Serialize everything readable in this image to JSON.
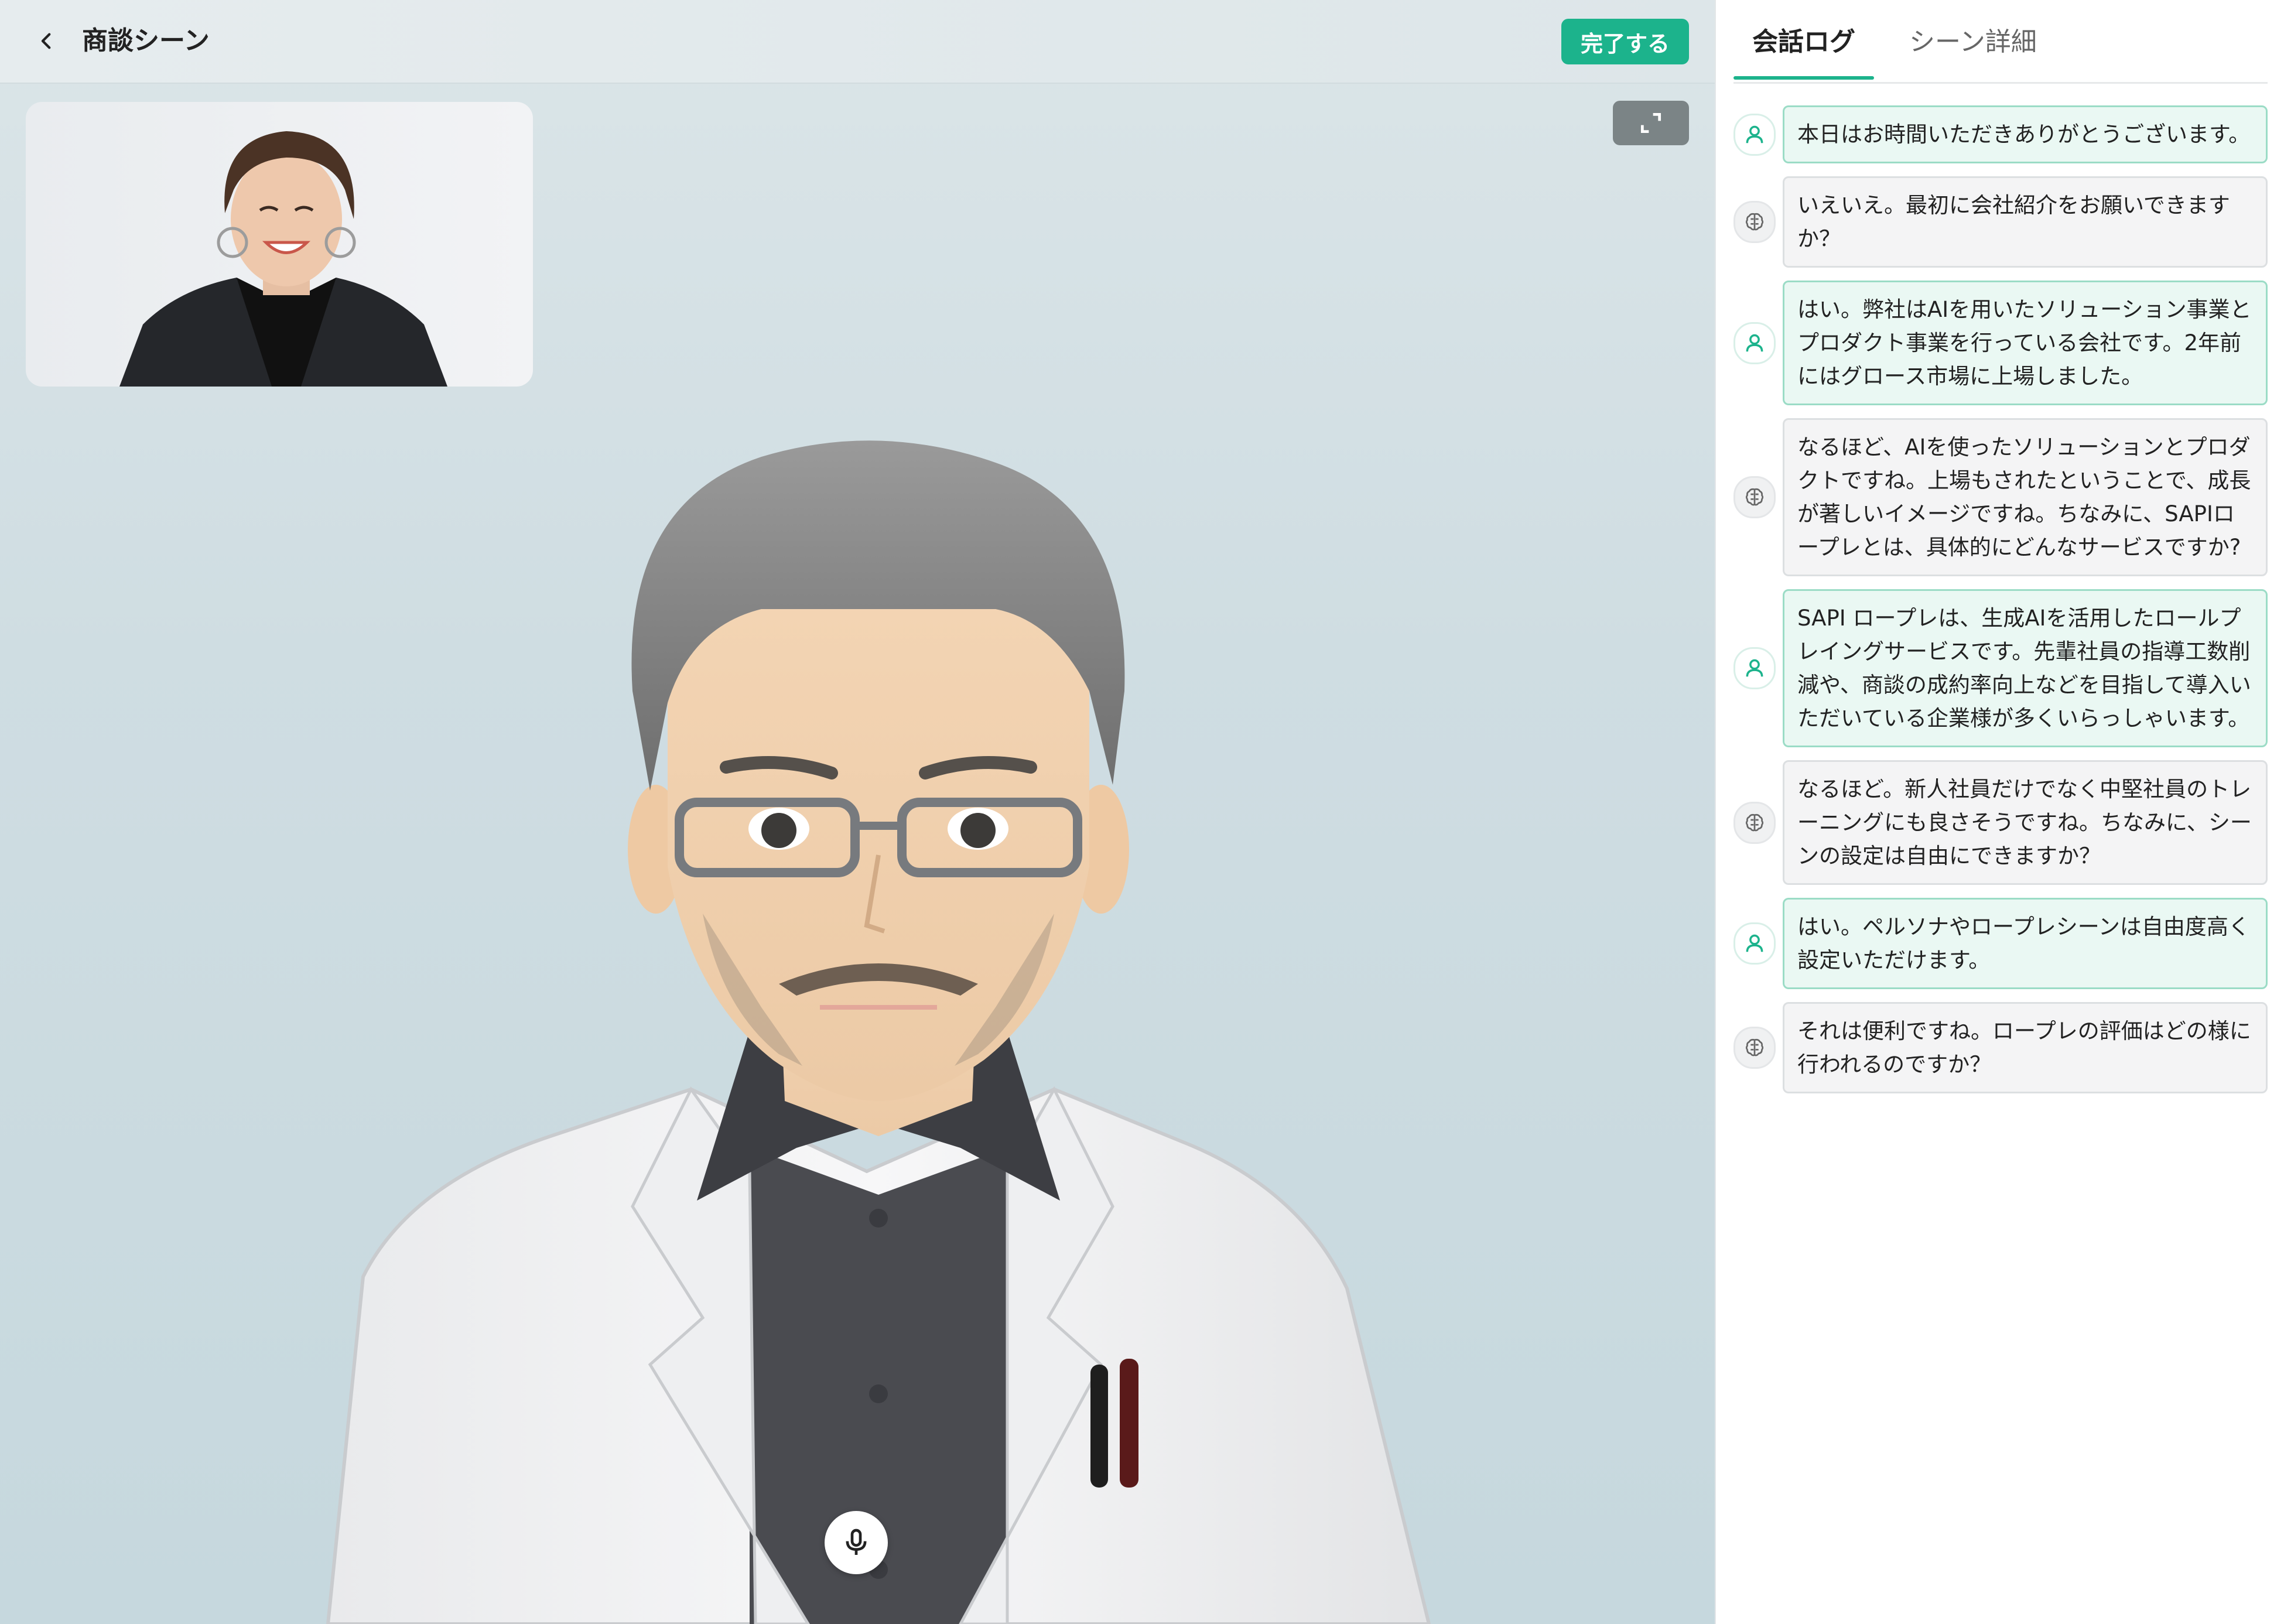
{
  "header": {
    "title": "商談シーン",
    "complete_label": "完了する"
  },
  "colors": {
    "accent": "#1cb38c",
    "user_bubble": "#eaf8f3",
    "ai_bubble": "#f4f4f5"
  },
  "tabs": [
    {
      "label": "会話ログ",
      "active": true
    },
    {
      "label": "シーン詳細",
      "active": false
    }
  ],
  "icons": {
    "back": "chevron-left-icon",
    "expand": "expand-icon",
    "mic": "microphone-icon",
    "user": "user-icon",
    "ai": "brain-icon"
  },
  "messages": [
    {
      "role": "user",
      "text": "本日はお時間いただきありがとうございます。"
    },
    {
      "role": "ai",
      "text": "いえいえ。最初に会社紹介をお願いできますか？"
    },
    {
      "role": "user",
      "text": "はい。弊社はAIを用いたソリューション事業とプロダクト事業を行っている会社です。2年前にはグロース市場に上場しました。"
    },
    {
      "role": "ai",
      "text": "なるほど、AIを使ったソリューションとプロダクトですね。上場もされたということで、成長が著しいイメージですね。ちなみに、SAPIロープレとは、具体的にどんなサービスですか?"
    },
    {
      "role": "user",
      "text": "SAPI ロープレは、生成AIを活用したロールプレイングサービスです。先輩社員の指導工数削減や、商談の成約率向上などを目指して導入いただいている企業様が多くいらっしゃいます。"
    },
    {
      "role": "ai",
      "text": "なるほど。新人社員だけでなく中堅社員のトレーニングにも良さそうですね。ちなみに、シーンの設定は自由にできますか？"
    },
    {
      "role": "user",
      "text": "はい。ペルソナやロープレシーンは自由度高く設定いただけます。"
    },
    {
      "role": "ai",
      "text": "それは便利ですね。ロープレの評価はどの様に行われるのですか？"
    }
  ]
}
